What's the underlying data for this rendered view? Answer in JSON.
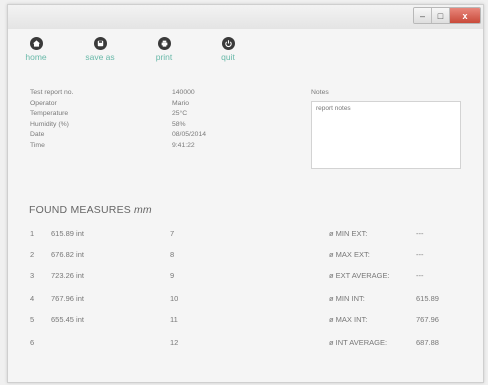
{
  "window": {
    "controls": {
      "minimize": "–",
      "maximize": "□",
      "close": "x"
    }
  },
  "toolbar": [
    {
      "id": "home",
      "label": "home",
      "icon": "home-icon"
    },
    {
      "id": "save",
      "label": "save as",
      "icon": "save-icon"
    },
    {
      "id": "print",
      "label": "print",
      "icon": "print-icon"
    },
    {
      "id": "quit",
      "label": "quit",
      "icon": "power-icon"
    }
  ],
  "accent_color": "#69b9a9",
  "info": [
    {
      "label": "Test report no.",
      "value": "140000"
    },
    {
      "label": "Operator",
      "value": "Mario"
    },
    {
      "label": "Temperature",
      "value": "25°C"
    },
    {
      "label": "Humidity (%)",
      "value": "58%"
    },
    {
      "label": "Date",
      "value": "08/05/2014"
    },
    {
      "label": "Time",
      "value": "9:41:22"
    }
  ],
  "notes": {
    "label": "Notes",
    "text": "report notes"
  },
  "found_measures": {
    "title": "FOUND MEASURES",
    "unit": "mm"
  },
  "measures_left": [
    {
      "index": "1",
      "value": "615.89 int"
    },
    {
      "index": "2",
      "value": "676.82 int"
    },
    {
      "index": "3",
      "value": "723.26 int"
    },
    {
      "index": "4",
      "value": "767.96 int"
    },
    {
      "index": "5",
      "value": "655.45 int"
    },
    {
      "index": "6",
      "value": ""
    }
  ],
  "measures_right": [
    {
      "index": "7"
    },
    {
      "index": "8"
    },
    {
      "index": "9"
    },
    {
      "index": "10"
    },
    {
      "index": "11"
    },
    {
      "index": "12"
    }
  ],
  "stats": [
    {
      "label": "ø MIN EXT:",
      "value": "---"
    },
    {
      "label": "ø MAX EXT:",
      "value": "---"
    },
    {
      "label": "ø EXT AVERAGE:",
      "value": "---"
    },
    {
      "label": "ø MIN INT:",
      "value": "615.89"
    },
    {
      "label": "ø MAX INT:",
      "value": "767.96"
    },
    {
      "label": "ø INT AVERAGE:",
      "value": "687.88"
    }
  ]
}
